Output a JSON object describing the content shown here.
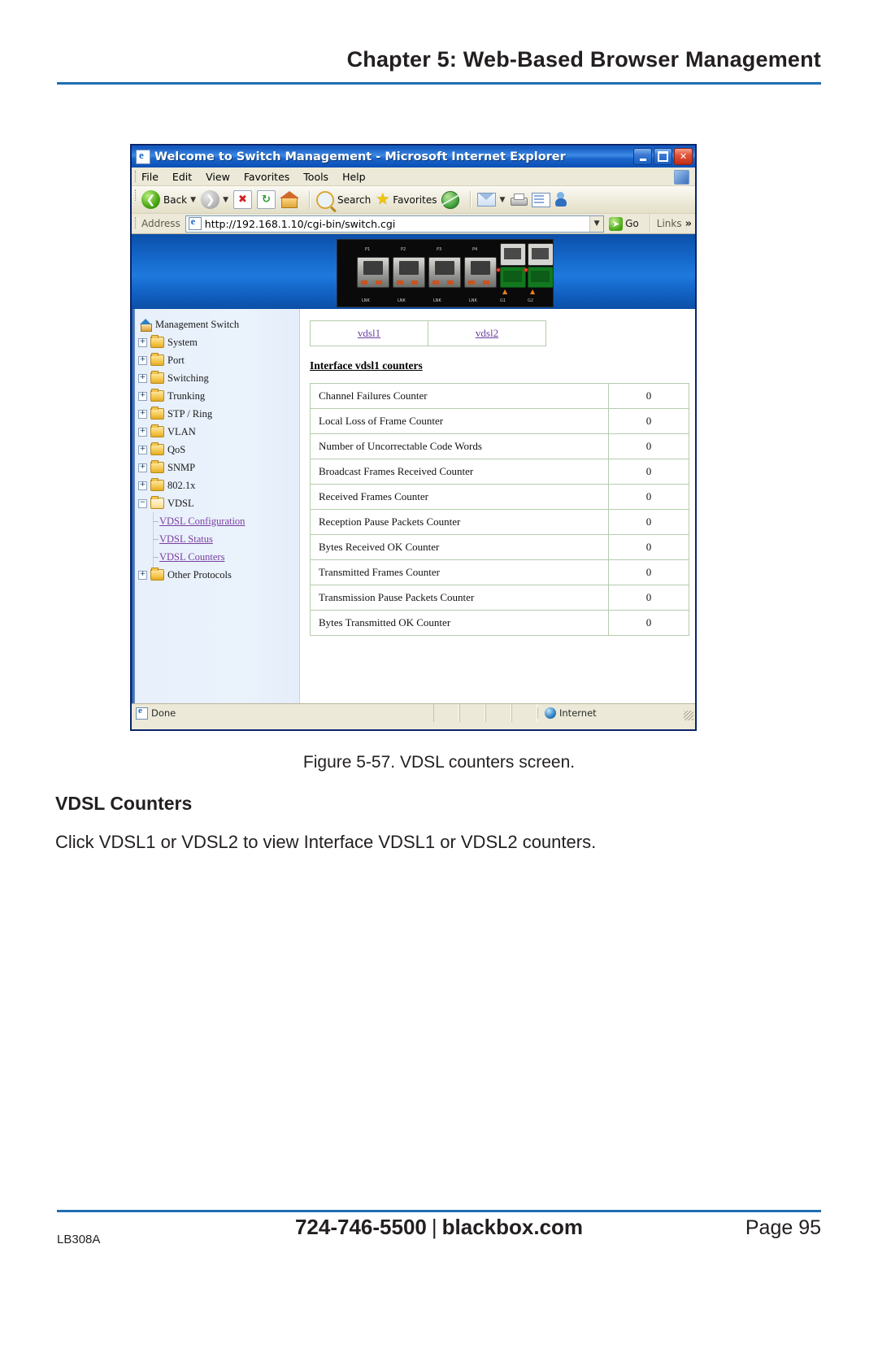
{
  "page": {
    "chapter_header": "Chapter 5: Web-Based Browser Management",
    "figure_caption": "Figure 5-57. VDSL counters screen.",
    "section_title": "VDSL Counters",
    "section_body": "Click VDSL1 or VDSL2 to view Interface VDSL1 or VDSL2 counters.",
    "footer_left": "LB308A",
    "footer_phone": "724-746-5500",
    "footer_separator": "|",
    "footer_site": "blackbox.com",
    "footer_page": "Page 95"
  },
  "browser": {
    "title": "Welcome to Switch Management - Microsoft Internet Explorer",
    "window_buttons": {
      "minimize": "minimize-button",
      "maximize": "maximize-button",
      "close": "✕"
    },
    "menu": [
      "File",
      "Edit",
      "View",
      "Favorites",
      "Tools",
      "Help"
    ],
    "toolbar": {
      "back": "Back",
      "forward": "forward-button",
      "stop": "✖",
      "refresh": "↻",
      "home": "home-button",
      "search": "Search",
      "favorites": "Favorites",
      "media": "media-button",
      "mail": "mail-button",
      "print": "print-button",
      "edit": "edit-button",
      "messenger": "messenger-button"
    },
    "address": {
      "label": "Address",
      "url": "http://192.168.1.10/cgi-bin/switch.cgi",
      "go": "Go",
      "links": "Links",
      "chevron": "»"
    },
    "status": {
      "text": "Done",
      "zone": "Internet"
    }
  },
  "tree": {
    "root": "Management Switch",
    "folders": [
      "System",
      "Port",
      "Switching",
      "Trunking",
      "STP / Ring",
      "VLAN",
      "QoS",
      "SNMP",
      "802.1x"
    ],
    "expanded_folder": "VDSL",
    "children": [
      "VDSL Configuration",
      "VDSL Status",
      "VDSL Counters"
    ],
    "last_folder": "Other Protocols",
    "expand_glyph": "+",
    "collapse_glyph": "−"
  },
  "main": {
    "tabs": [
      "vdsl1",
      "vdsl2"
    ],
    "title": "Interface vdsl1 counters",
    "rows": [
      {
        "name": "Channel Failures Counter",
        "value": "0"
      },
      {
        "name": "Local Loss of Frame Counter",
        "value": "0"
      },
      {
        "name": "Number of Uncorrectable Code Words",
        "value": "0"
      },
      {
        "name": "Broadcast Frames Received Counter",
        "value": "0"
      },
      {
        "name": "Received Frames Counter",
        "value": "0"
      },
      {
        "name": "Reception Pause Packets Counter",
        "value": "0"
      },
      {
        "name": "Bytes Received OK Counter",
        "value": "0"
      },
      {
        "name": "Transmitted Frames Counter",
        "value": "0"
      },
      {
        "name": "Transmission Pause Packets Counter",
        "value": "0"
      },
      {
        "name": "Bytes Transmitted OK Counter",
        "value": "0"
      }
    ]
  },
  "colors": {
    "accent_rule": "#1f6fb2",
    "titlebar_blue": "#1257bd",
    "link_purple": "#7b3fa0",
    "table_border": "#b5ccae"
  }
}
